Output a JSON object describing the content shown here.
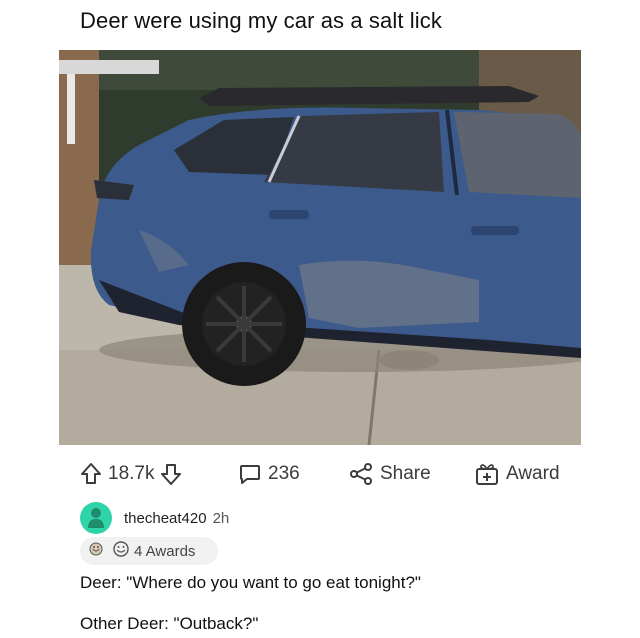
{
  "post": {
    "title": "Deer were using my car as a salt lick"
  },
  "actions": {
    "upvotes": "18.7k",
    "comments": "236",
    "share_label": "Share",
    "award_label": "Award"
  },
  "comment": {
    "username": "thecheat420",
    "time": "2h",
    "awards": "4 Awards",
    "lines": [
      "Deer: \"Where do you want to go eat tonight?\"",
      "Other Deer: \"Outback?\""
    ]
  },
  "icons": {
    "upvote": "arrow-up-icon",
    "downvote": "arrow-down-icon",
    "comment": "speech-bubble-icon",
    "share": "share-icon",
    "award": "gift-icon"
  },
  "colors": {
    "avatar": "#2fd3a8",
    "car": "#3c5a8c"
  }
}
